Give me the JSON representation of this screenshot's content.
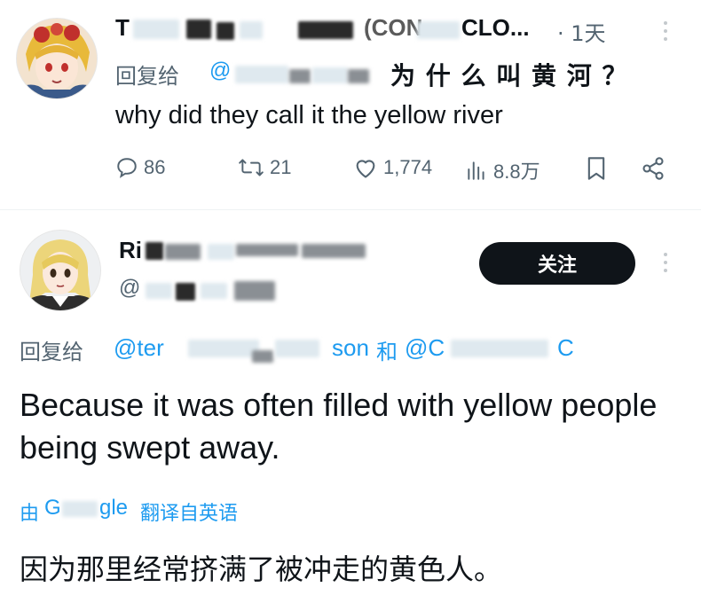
{
  "tweet1": {
    "name_visible_start": "T",
    "name_visible_end": "CLO...",
    "name_mid_fragment": "(CON",
    "time": "· 1天",
    "reply_prefix": "回复给",
    "reply_handle_start": "@",
    "reply_cn_text": "为 什 么 叫 黄 河 ？",
    "body": "why did they call it the yellow river",
    "stats": {
      "replies": "86",
      "retweets": "21",
      "likes": "1,774",
      "views": "8.8万"
    }
  },
  "tweet2": {
    "name_visible_start": "Ri",
    "handle_start": "@",
    "follow_label": "关注",
    "reply_prefix": "回复给",
    "reply_handle_1": "@ter",
    "reply_handle_1_end": "son",
    "reply_and": "和",
    "reply_handle_2": "@C",
    "reply_handle_2_end": "C",
    "body": "Because it was often filled with yellow people being swept away.",
    "translate_prefix": "由",
    "translate_g": "G",
    "translate_gle": "gle",
    "translate_suffix": "翻译自英语",
    "translation": "因为那里经常挤满了被冲走的黄色人。"
  },
  "colors": {
    "link_blue": "#1d9bf0",
    "meta_gray": "#536471",
    "text": "#0f1419",
    "follow_button_bg": "#0f1419"
  }
}
